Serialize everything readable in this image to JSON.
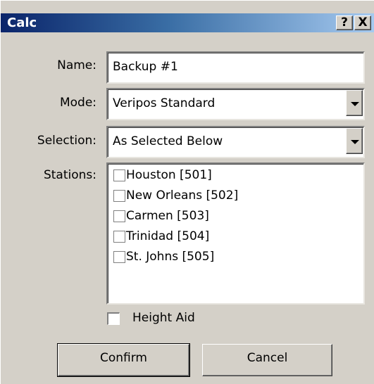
{
  "window": {
    "title": "Calc",
    "help_label": "?",
    "close_label": "X"
  },
  "form": {
    "name_label": "Name:",
    "name_value": "Backup #1",
    "mode_label": "Mode:",
    "mode_value": "Veripos Standard",
    "selection_label": "Selection:",
    "selection_value": "As Selected Below",
    "stations_label": "Stations:",
    "stations": [
      {
        "label": "Houston [501]",
        "checked": false
      },
      {
        "label": "New Orleans [502]",
        "checked": false
      },
      {
        "label": "Carmen [503]",
        "checked": false
      },
      {
        "label": "Trinidad [504]",
        "checked": false
      },
      {
        "label": "St. Johns [505]",
        "checked": false
      }
    ],
    "height_aid_label": "Height Aid",
    "height_aid_checked": false
  },
  "buttons": {
    "confirm": "Confirm",
    "cancel": "Cancel"
  },
  "icons": {
    "dropdown": "chevron-down-icon",
    "checkbox": "checkbox-unchecked-icon"
  },
  "colors": {
    "title_start": "#0a246a",
    "title_end": "#a6caf0",
    "dialog_bg": "#d4d0c8"
  }
}
